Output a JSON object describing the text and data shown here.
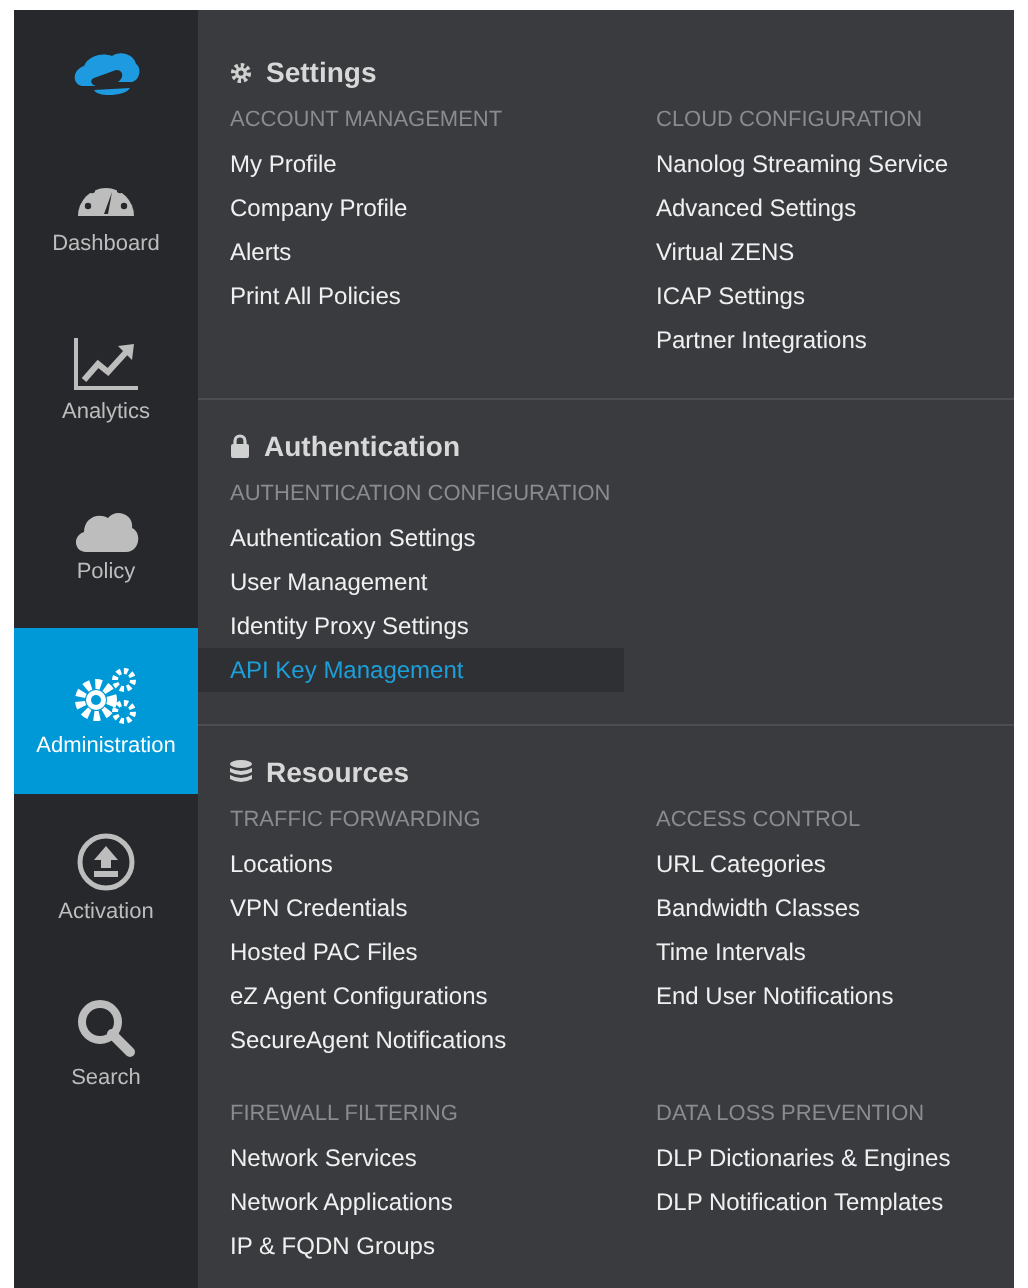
{
  "sidebar": {
    "items": [
      {
        "kind": "dashboard",
        "label": "Dashboard",
        "selected": false
      },
      {
        "kind": "analytics",
        "label": "Analytics",
        "selected": false
      },
      {
        "kind": "policy",
        "label": "Policy",
        "selected": false
      },
      {
        "kind": "administration",
        "label": "Administration",
        "selected": true
      },
      {
        "kind": "activation",
        "label": "Activation",
        "selected": false
      },
      {
        "kind": "search",
        "label": "Search",
        "selected": false
      }
    ]
  },
  "menu": {
    "sections": [
      {
        "kind": "settings",
        "title": "Settings",
        "groups": [
          {
            "heading": "ACCOUNT MANAGEMENT",
            "items": [
              {
                "label": "My Profile",
                "selected": false
              },
              {
                "label": "Company Profile",
                "selected": false
              },
              {
                "label": "Alerts",
                "selected": false
              },
              {
                "label": "Print All Policies",
                "selected": false
              }
            ]
          },
          {
            "heading": "CLOUD CONFIGURATION",
            "items": [
              {
                "label": "Nanolog Streaming Service",
                "selected": false
              },
              {
                "label": "Advanced Settings",
                "selected": false
              },
              {
                "label": "Virtual ZENS",
                "selected": false
              },
              {
                "label": "ICAP Settings",
                "selected": false
              },
              {
                "label": "Partner Integrations",
                "selected": false
              }
            ]
          }
        ]
      },
      {
        "kind": "authentication",
        "title": "Authentication",
        "groups": [
          {
            "heading": "AUTHENTICATION CONFIGURATION",
            "items": [
              {
                "label": "Authentication Settings",
                "selected": false
              },
              {
                "label": "User Management",
                "selected": false
              },
              {
                "label": "Identity Proxy Settings",
                "selected": false
              },
              {
                "label": "API Key Management",
                "selected": true
              }
            ]
          }
        ]
      },
      {
        "kind": "resources",
        "title": "Resources",
        "groups": [
          {
            "heading": "TRAFFIC FORWARDING",
            "items": [
              {
                "label": "Locations",
                "selected": false
              },
              {
                "label": "VPN Credentials",
                "selected": false
              },
              {
                "label": "Hosted PAC Files",
                "selected": false
              },
              {
                "label": "eZ Agent Configurations",
                "selected": false
              },
              {
                "label": "SecureAgent Notifications",
                "selected": false
              }
            ]
          },
          {
            "heading": "ACCESS CONTROL",
            "items": [
              {
                "label": "URL Categories",
                "selected": false
              },
              {
                "label": "Bandwidth Classes",
                "selected": false
              },
              {
                "label": "Time Intervals",
                "selected": false
              },
              {
                "label": "End User Notifications",
                "selected": false
              }
            ]
          },
          {
            "heading": "FIREWALL FILTERING",
            "items": [
              {
                "label": "Network Services",
                "selected": false
              },
              {
                "label": "Network Applications",
                "selected": false
              },
              {
                "label": "IP & FQDN Groups",
                "selected": false
              }
            ]
          },
          {
            "heading": "DATA LOSS PREVENTION",
            "items": [
              {
                "label": "DLP Dictionaries & Engines",
                "selected": false
              },
              {
                "label": "DLP Notification Templates",
                "selected": false
              }
            ]
          }
        ]
      }
    ]
  }
}
